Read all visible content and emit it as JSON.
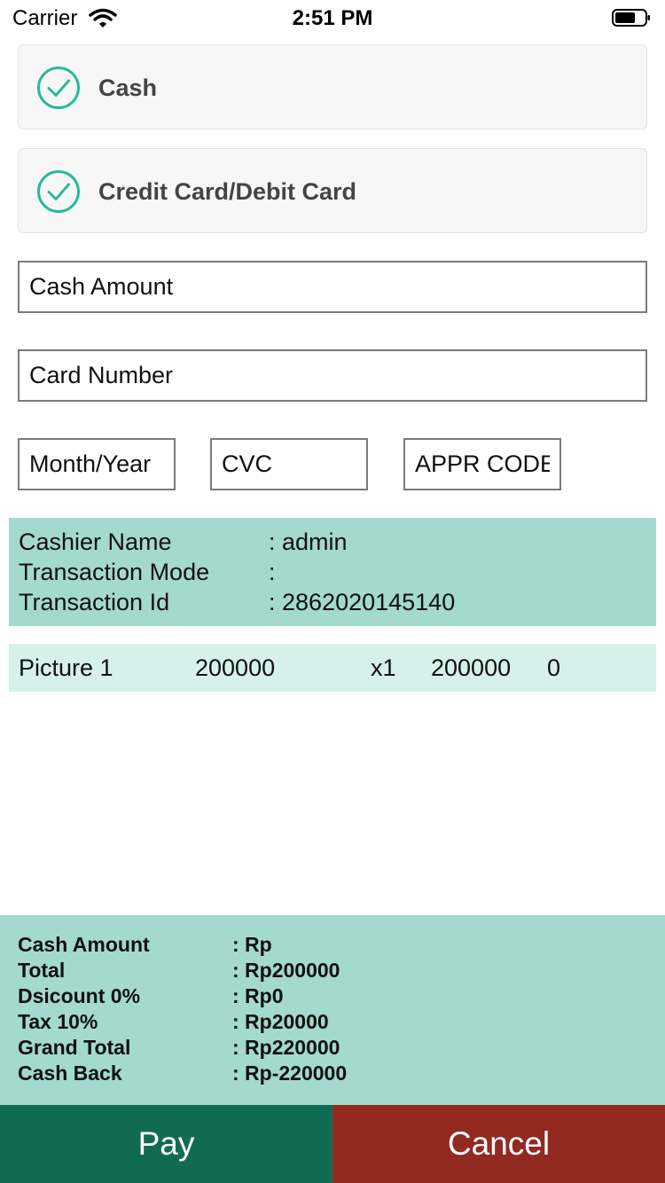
{
  "status_bar": {
    "carrier": "Carrier",
    "time": "2:51 PM",
    "icons": [
      "wifi-icon",
      "battery-icon"
    ]
  },
  "payment_options": [
    {
      "label": "Cash",
      "selected": true,
      "icon": "check-circle-icon"
    },
    {
      "label": "Credit Card/Debit Card",
      "selected": true,
      "icon": "check-circle-icon"
    }
  ],
  "form": {
    "cash_amount": {
      "value": "",
      "placeholder": "Cash Amount"
    },
    "card_number": {
      "value": "",
      "placeholder": "Card Number"
    },
    "month_year": {
      "value": "",
      "placeholder": "Month/Year"
    },
    "cvc": {
      "value": "",
      "placeholder": "CVC"
    },
    "appr_code": {
      "value": "",
      "placeholder": "APPR CODE"
    }
  },
  "transaction_info": [
    {
      "label": "Cashier Name",
      "value": ": admin"
    },
    {
      "label": "Transaction Mode",
      "value": ":"
    },
    {
      "label": "Transaction Id",
      "value": ": 2862020145140"
    }
  ],
  "items": [
    {
      "name": "Picture 1",
      "price": "200000",
      "qty": "x1",
      "subtotal": "200000",
      "discount": "0"
    }
  ],
  "summary": [
    {
      "label": "Cash Amount",
      "value": ": Rp"
    },
    {
      "label": "Total",
      "value": ": Rp200000"
    },
    {
      "label": "Dsicount 0%",
      "value": ": Rp0"
    },
    {
      "label": "Tax 10%",
      "value": ": Rp20000"
    },
    {
      "label": "Grand Total",
      "value": ": Rp220000"
    },
    {
      "label": "Cash Back",
      "value": ": Rp-220000"
    }
  ],
  "buttons": {
    "pay": "Pay",
    "cancel": "Cancel"
  },
  "colors": {
    "accent_check": "#2bb99a",
    "panel": "#a3d9cf",
    "item_row": "#d5f1ea",
    "pay_button": "#116b52",
    "cancel_button": "#922a22"
  }
}
